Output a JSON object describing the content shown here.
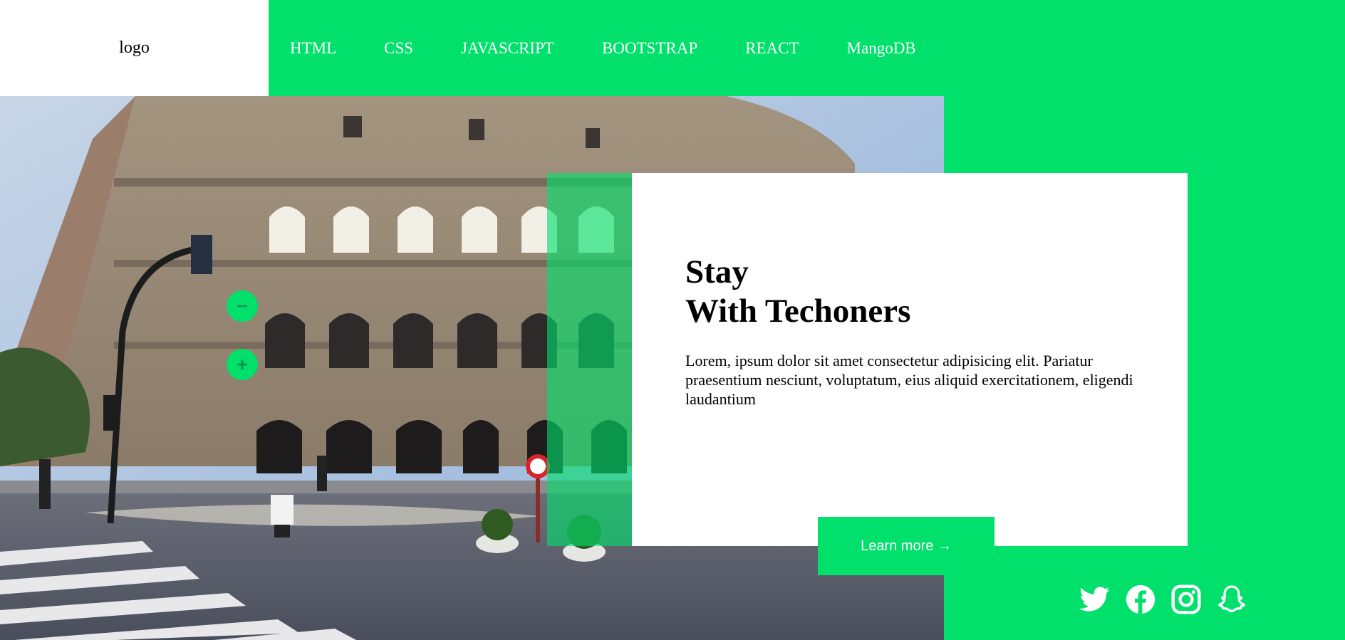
{
  "header": {
    "logo": "logo",
    "nav": [
      {
        "label": "HTML"
      },
      {
        "label": "CSS"
      },
      {
        "label": "JAVASCRIPT"
      },
      {
        "label": "BOOTSTRAP"
      },
      {
        "label": "REACT"
      },
      {
        "label": "MangoDB"
      }
    ]
  },
  "hero": {
    "image_icon": "colosseum-photo",
    "title_line1": "Stay",
    "title_line2": "With Techoners",
    "text": "Lorem, ipsum dolor sit amet consectetur adipisicing elit. Pariatur praesentium nesciunt, voluptatum, eius aliquid exercitationem, eligendi laudantium",
    "button_label": "Learn more →"
  },
  "controls": {
    "minus_icon": "minus-icon",
    "plus_icon": "plus-icon"
  },
  "social": [
    "twitter-icon",
    "facebook-icon",
    "instagram-icon",
    "snapchat-icon"
  ],
  "colors": {
    "accent": "#00e06b",
    "white": "#ffffff",
    "text": "#000000"
  }
}
